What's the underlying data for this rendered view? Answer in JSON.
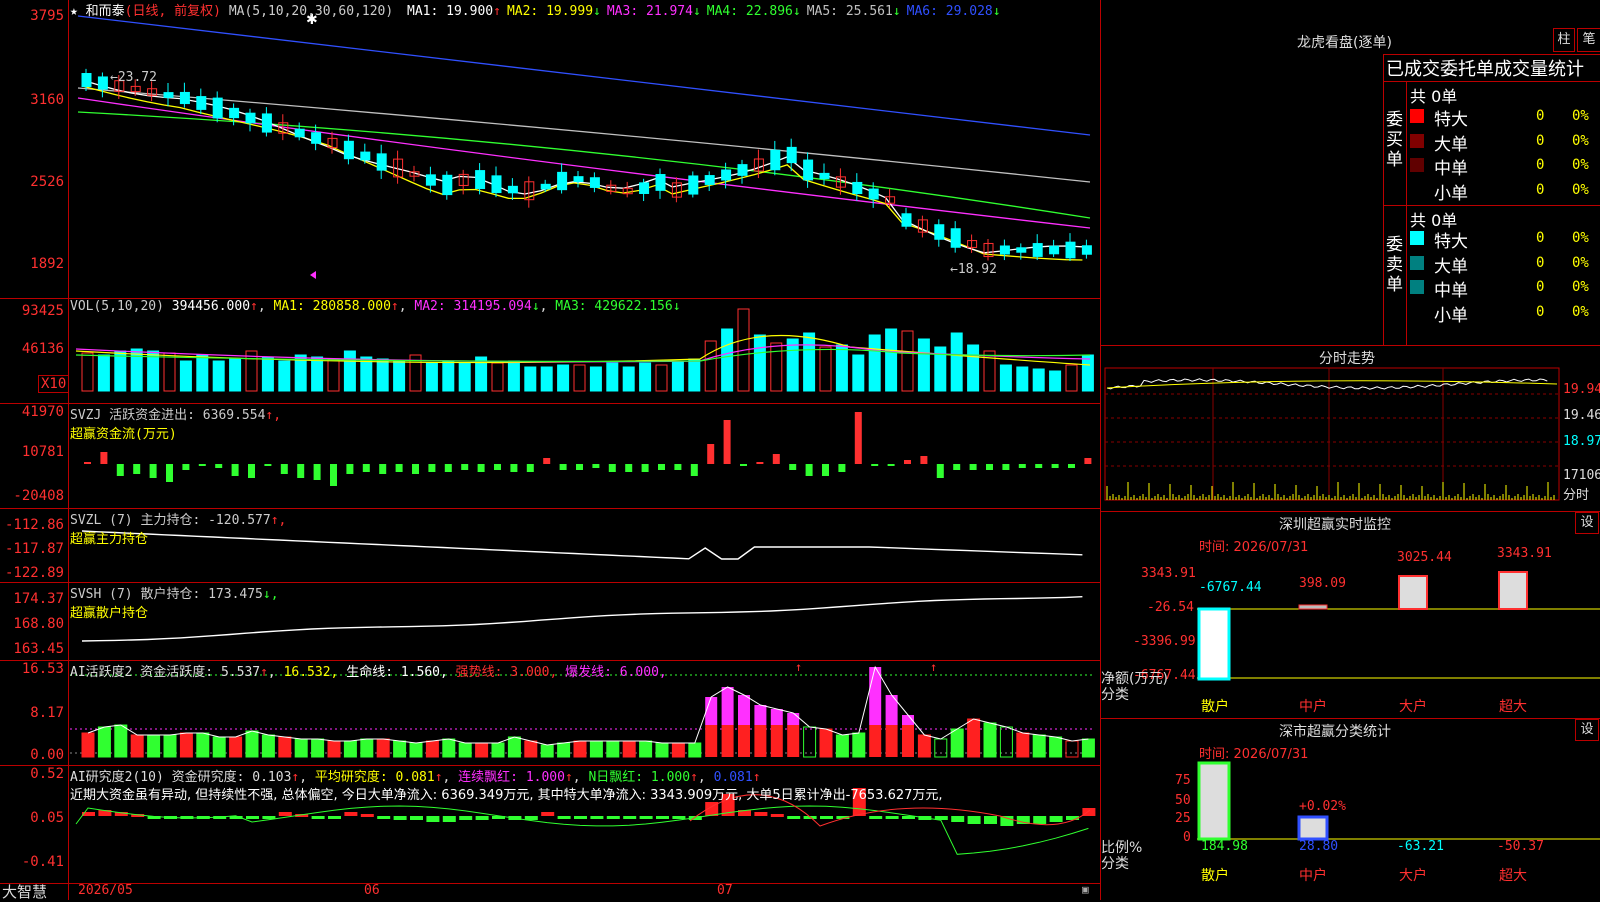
{
  "stock": {
    "star": "★",
    "name": "和而泰",
    "period": "(日线, 前复权)",
    "ma_label": "MA(5,10,20,30,60,120)",
    "ma_items": [
      {
        "label": "MA1:",
        "value": "19.900",
        "arrow": "↑",
        "color": "#ffffff"
      },
      {
        "label": "MA2:",
        "value": "19.999",
        "arrow": "↓",
        "color": "#ffff00"
      },
      {
        "label": "MA3:",
        "value": "21.974",
        "arrow": "↓",
        "color": "#ff30ff"
      },
      {
        "label": "MA4:",
        "value": "22.896",
        "arrow": "↓",
        "color": "#30ff30"
      },
      {
        "label": "MA5:",
        "value": "25.561",
        "arrow": "↓",
        "color": "#c0c0c0"
      },
      {
        "label": "MA6:",
        "value": "29.028",
        "arrow": "↓",
        "color": "#3050ff"
      }
    ],
    "price_ticks": [
      "3795",
      "3160",
      "2526",
      "1892"
    ],
    "high_mark": "23.72",
    "low_mark": "←18.92",
    "arrow_left": "←"
  },
  "vol": {
    "label": "VOL(5,10,20)",
    "value": "394456.000",
    "ma1": "MA1: 280858.000",
    "ma1_arrow": "↑",
    "ma2": "MA2: 314195.094",
    "ma2_arrow": "↓",
    "ma3": "MA3: 429622.156",
    "ma3_arrow": "↓",
    "ticks": [
      "93425",
      "46136"
    ],
    "unit": "X10"
  },
  "svzj": {
    "label": "SVZJ  活跃资金进出: 6369.554",
    "arrow": "↑,",
    "sub": "超赢资金流(万元)",
    "ticks": [
      "41970",
      "10781",
      "-20408"
    ]
  },
  "svzl": {
    "label": "SVZL (7) 主力持仓: -120.577",
    "arrow": "↑,",
    "sub": "超赢主力持仓",
    "ticks": [
      "-112.86",
      "-117.87",
      "-122.89"
    ]
  },
  "svsh": {
    "label": "SVSH (7) 散户持仓: 173.475",
    "arrow": "↓,",
    "sub": "超赢散户持仓",
    "ticks": [
      "174.37",
      "168.80",
      "163.45"
    ]
  },
  "ai_active": {
    "label": "AI活跃度2 资金活跃度: 5.537",
    "v2": "16.532,",
    "v3": "生命线: 1.560,",
    "v4": "强势线: 3.000,",
    "v5": "爆发线: 6.000,",
    "ticks": [
      "16.53",
      "8.17",
      "0.00"
    ]
  },
  "ai_research": {
    "label": "AI研究度2(10) 资金研究度: 0.103",
    "v2": "平均研究度: 0.081",
    "v3": "连续飘红: 1.000",
    "v4": "N日飘红: 1.000",
    "v5": "0.081",
    "comment": "近期大资金虽有异动, 但持续性不强, 总体偏空, 今日大单净流入: 6369.349万元, 其中特大单净流入: 3343.909万元, 大单5日累计净出-7653.627万元,",
    "ticks": [
      "0.52",
      "0.05",
      "-0.41"
    ]
  },
  "footer": {
    "brand": "大智慧",
    "dates": [
      "2026/05",
      "06",
      "07"
    ]
  },
  "right": {
    "lh_title": "龙虎看盘(逐单)",
    "btn1": "柱",
    "btn2": "笔",
    "stats_title": "已成交委托单成交量统计",
    "buy_side": "委买单",
    "sell_side": "委卖单",
    "buy_total": "共 0单",
    "sell_total": "共 0单",
    "rows": [
      {
        "label": "特大",
        "count": "0",
        "pct": "0%"
      },
      {
        "label": "大单",
        "count": "0",
        "pct": "0%"
      },
      {
        "label": "中单",
        "count": "0",
        "pct": "0%"
      },
      {
        "label": "小单",
        "count": "0",
        "pct": "0%"
      }
    ],
    "buy_colors": [
      "#ff0000",
      "#800000",
      "#600000",
      "#000000"
    ],
    "sell_colors": [
      "#00ffff",
      "#008080",
      "#008080",
      "#000000"
    ],
    "intraday_title": "分时走势",
    "intraday_ticks": [
      "19.94",
      "19.46",
      "18.97",
      "17106",
      "分时"
    ],
    "monitor_title": "深圳超赢实时监控",
    "monitor_set": "设",
    "monitor_time": "时间: 2026/07/31",
    "monitor_ticks": [
      "3343.91",
      "-26.54",
      "-3396.99",
      "-6767.44"
    ],
    "monitor_axis_label": "净额(万元)",
    "monitor_axis_label2": "分类",
    "monitor_bar_labels": [
      "-6767.44",
      "398.09",
      "3025.44",
      "3343.91"
    ],
    "categories": [
      "散户",
      "中户",
      "大户",
      "超大"
    ],
    "class_title": "深市超赢分类统计",
    "class_set": "设",
    "class_time": "时间: 2026/07/31",
    "class_ticks": [
      "75",
      "50",
      "25",
      "0"
    ],
    "class_axis_label": "比例%",
    "class_axis_label2": "分类",
    "class_top_label": "+0.02%",
    "class_values": [
      "184.98",
      "28.80",
      "-63.21",
      "-50.37"
    ]
  }
}
